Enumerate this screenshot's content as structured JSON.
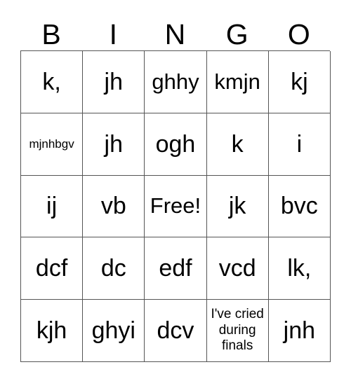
{
  "card": {
    "title": "BINGO",
    "header": {
      "letters": [
        "B",
        "I",
        "N",
        "G",
        "O"
      ]
    },
    "grid": {
      "rows": 5,
      "columns": 5,
      "line_color": "#555555",
      "background_color": "#ffffff",
      "text_color": "#000000",
      "cells": [
        [
          {
            "text": "k,",
            "size": "lg",
            "free": false
          },
          {
            "text": "jh",
            "size": "lg",
            "free": false
          },
          {
            "text": "ghhy",
            "size": "md",
            "free": false
          },
          {
            "text": "kmjn",
            "size": "md",
            "free": false
          },
          {
            "text": "kj",
            "size": "lg",
            "free": false
          }
        ],
        [
          {
            "text": "mjnhbgv",
            "size": "xs",
            "free": false
          },
          {
            "text": "jh",
            "size": "lg",
            "free": false
          },
          {
            "text": "ogh",
            "size": "lg",
            "free": false
          },
          {
            "text": "k",
            "size": "lg",
            "free": false
          },
          {
            "text": "i",
            "size": "lg",
            "free": false
          }
        ],
        [
          {
            "text": "ij",
            "size": "lg",
            "free": false
          },
          {
            "text": "vb",
            "size": "lg",
            "free": false
          },
          {
            "text": "Free!",
            "size": "md",
            "free": true
          },
          {
            "text": "jk",
            "size": "lg",
            "free": false
          },
          {
            "text": "bvc",
            "size": "lg",
            "free": false
          }
        ],
        [
          {
            "text": "dcf",
            "size": "lg",
            "free": false
          },
          {
            "text": "dc",
            "size": "lg",
            "free": false
          },
          {
            "text": "edf",
            "size": "lg",
            "free": false
          },
          {
            "text": "vcd",
            "size": "lg",
            "free": false
          },
          {
            "text": "lk,",
            "size": "lg",
            "free": false
          }
        ],
        [
          {
            "text": "kjh",
            "size": "lg",
            "free": false
          },
          {
            "text": "ghyi",
            "size": "lg",
            "free": false
          },
          {
            "text": "dcv",
            "size": "lg",
            "free": false
          },
          {
            "text": "I've cried\nduring\nfinals",
            "size": "sm",
            "free": false
          },
          {
            "text": "jnh",
            "size": "lg",
            "free": false
          }
        ]
      ]
    }
  }
}
